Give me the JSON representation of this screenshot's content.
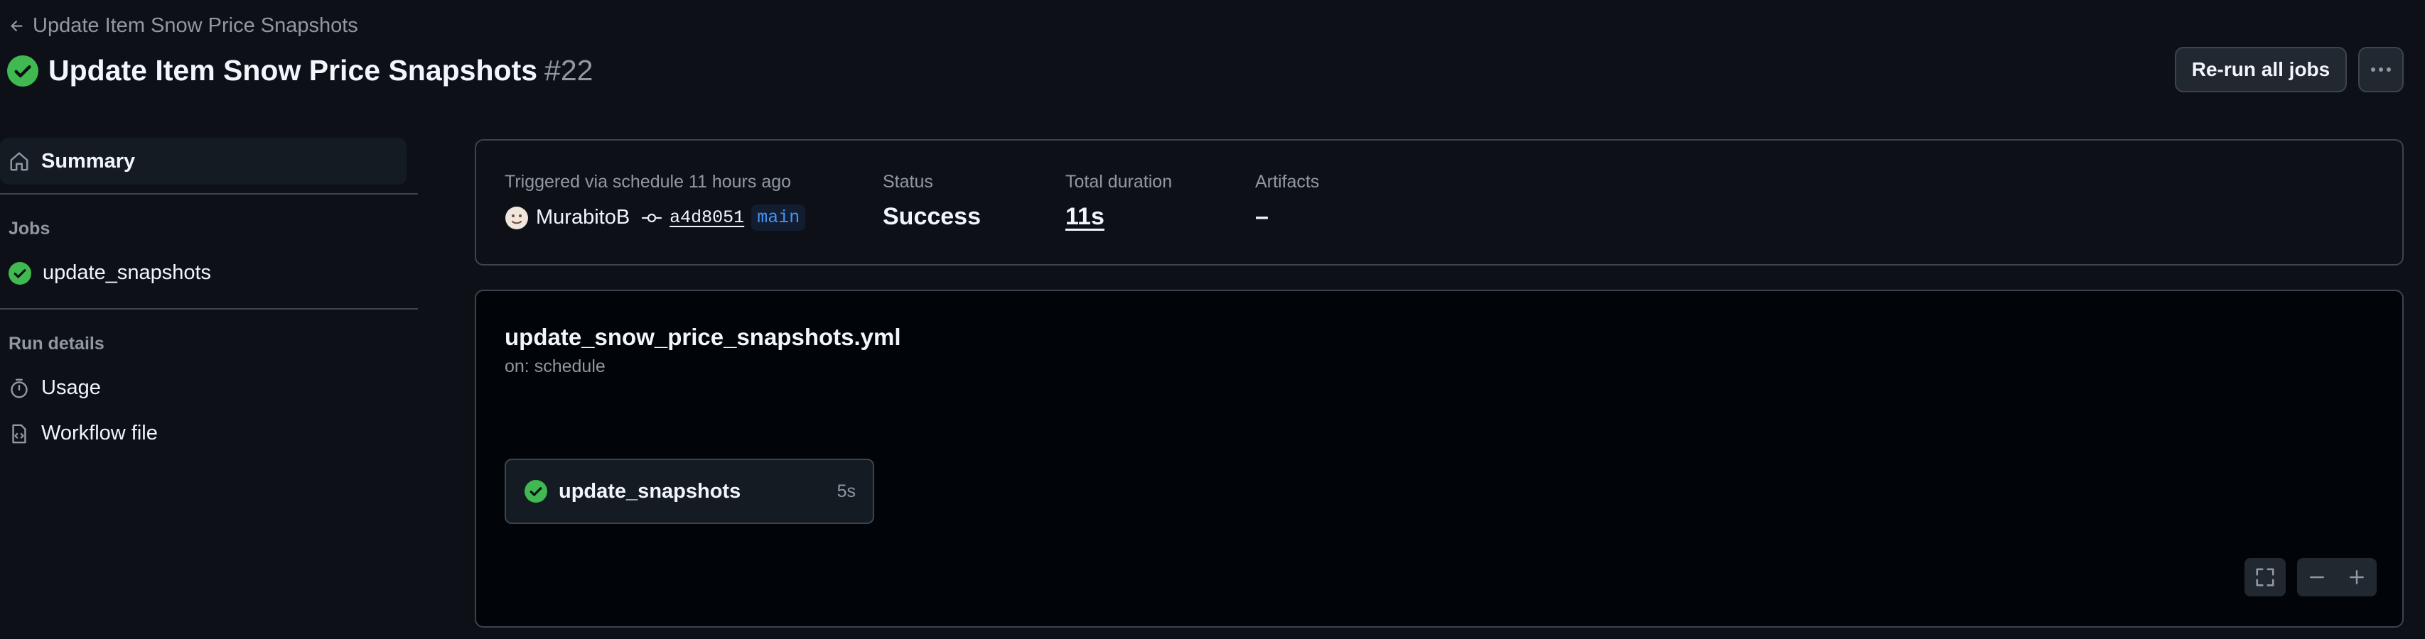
{
  "header": {
    "back_label": "Update Item Snow Price Snapshots",
    "title": "Update Item Snow Price Snapshots",
    "run_number": "#22",
    "rerun_label": "Re-run all jobs",
    "more_icon": "kebab-horizontal-icon"
  },
  "sidebar": {
    "summary_label": "Summary",
    "jobs_heading": "Jobs",
    "jobs": [
      {
        "label": "update_snapshots",
        "status": "success"
      }
    ],
    "run_details_heading": "Run details",
    "details": [
      {
        "label": "Usage",
        "icon": "stopwatch-icon"
      },
      {
        "label": "Workflow file",
        "icon": "file-code-icon"
      }
    ]
  },
  "summary": {
    "trigger_label": "Triggered via schedule 11 hours ago",
    "actor": "MurabitoB",
    "commit_sha": "a4d8051",
    "branch": "main",
    "status_label": "Status",
    "status_value": "Success",
    "duration_label": "Total duration",
    "duration_value": "11s",
    "artifacts_label": "Artifacts",
    "artifacts_value": "–"
  },
  "workflow": {
    "file_name": "update_snow_price_snapshots.yml",
    "trigger": "on: schedule",
    "job": {
      "name": "update_snapshots",
      "duration": "5s"
    }
  },
  "colors": {
    "success": "#3fb950",
    "background": "#0d1117",
    "border": "#3d444d",
    "muted": "#9198a1",
    "accent": "#4493f8"
  }
}
